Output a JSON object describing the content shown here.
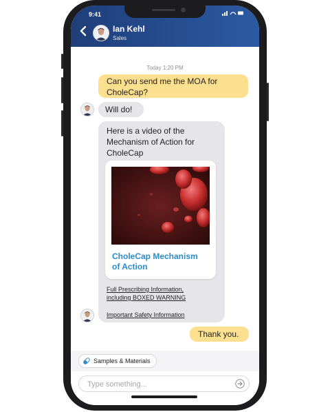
{
  "status_bar": {
    "time": "9:41",
    "icons": "▮▮ ◠ ▬"
  },
  "header": {
    "name": "Ian Kehl",
    "subtitle": "Sales"
  },
  "chat": {
    "timestamp": "Today 1:20 PM",
    "msg1": {
      "line1": "Can you send me the MOA for",
      "line2": "CholeCap?"
    },
    "msg2": "Will do!",
    "msg3": {
      "line1": "Here is a video of the",
      "line2": "Mechanism of Action for",
      "line3": "CholeCap"
    },
    "video_title": {
      "line1": "CholeCap Mechanism",
      "line2": "of Action"
    },
    "link1": {
      "line1": "Full Prescribing Information,",
      "line2": "including BOXED WARNING"
    },
    "link2": "Important Safety Information",
    "msg4": "Thank you."
  },
  "composer": {
    "samples_label": "Samples & Materials",
    "placeholder": "Type something..."
  },
  "colors": {
    "header": "#1f3e79",
    "outgoing_bubble": "#fde08f",
    "incoming_bubble": "#e6e6ea",
    "link_title": "#2e8bc9"
  },
  "icons": [
    "back-chevron-icon",
    "avatar",
    "send-arrow-icon",
    "pill-icon",
    "play-video-thumbnail"
  ]
}
